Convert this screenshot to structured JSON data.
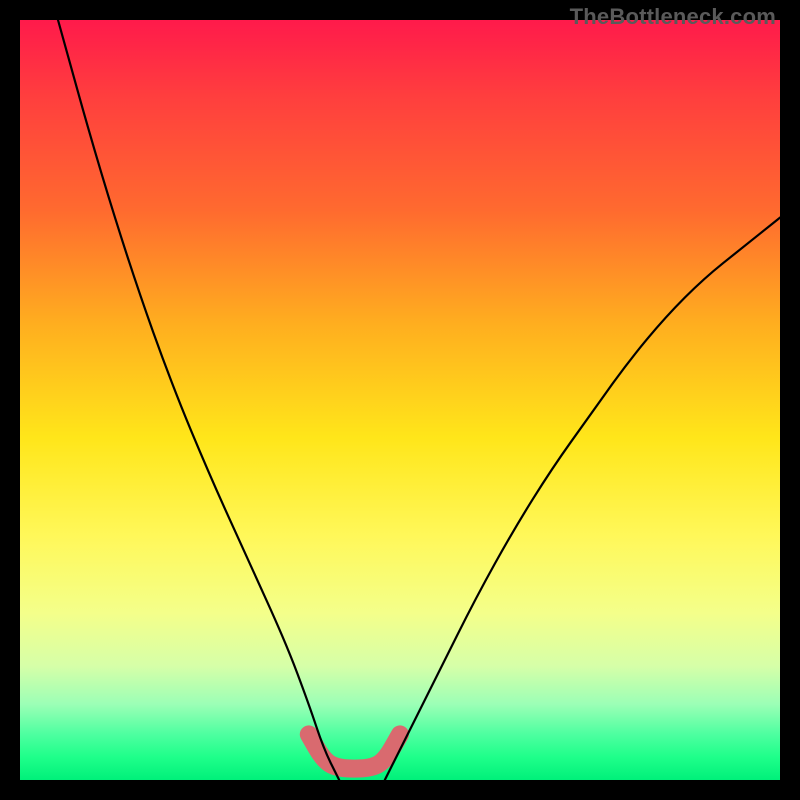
{
  "watermark": "TheBottleneck.com",
  "chart_data": {
    "type": "line",
    "title": "",
    "xlabel": "",
    "ylabel": "",
    "xlim": [
      0,
      100
    ],
    "ylim": [
      0,
      100
    ],
    "series": [
      {
        "name": "left-curve",
        "x": [
          5,
          10,
          15,
          20,
          25,
          30,
          35,
          38,
          40,
          42
        ],
        "y": [
          100,
          82,
          66,
          52,
          40,
          29,
          18,
          10,
          4,
          0
        ]
      },
      {
        "name": "right-curve",
        "x": [
          48,
          50,
          55,
          60,
          65,
          70,
          75,
          80,
          85,
          90,
          95,
          100
        ],
        "y": [
          0,
          4,
          14,
          24,
          33,
          41,
          48,
          55,
          61,
          66,
          70,
          74
        ]
      },
      {
        "name": "trough-highlight",
        "x": [
          38,
          40,
          42,
          46,
          48,
          50
        ],
        "y": [
          6,
          2.5,
          1.5,
          1.5,
          2.5,
          6
        ]
      }
    ],
    "grid": false,
    "legend": false
  },
  "colors": {
    "curve": "#000000",
    "highlight": "#d96a6f"
  }
}
